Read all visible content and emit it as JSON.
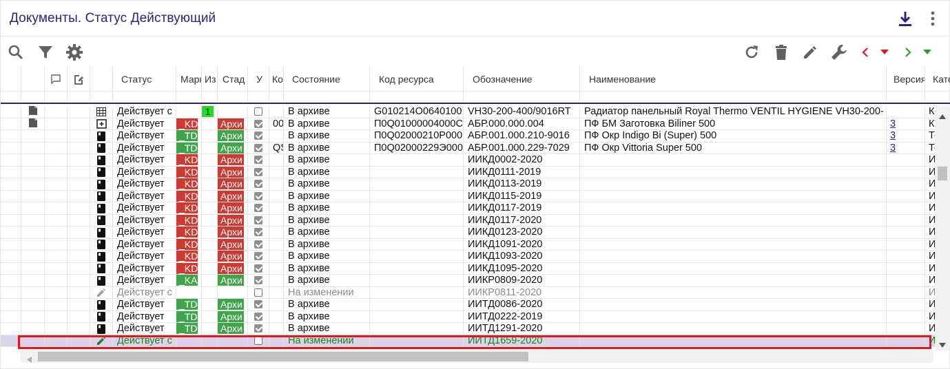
{
  "title": "Документы. Статус Действующий",
  "header_icons": {
    "download": "download-icon",
    "more": "more-vert-icon"
  },
  "toolbar": {
    "left": [
      "search-icon",
      "filter-icon",
      "settings-icon"
    ],
    "right": [
      "refresh-icon",
      "delete-icon",
      "edit-icon",
      "wrench-icon",
      "chevron-left-icon",
      "caret-down-red-icon",
      "chevron-right-icon",
      "caret-down-green-icon"
    ]
  },
  "colors": {
    "title": "#2a2380",
    "selected_row": "#dcd3ea",
    "selection_frame": "#e8141a",
    "tag_red": "#cc3b33",
    "tag_green": "#3fa44a",
    "tag_lime": "#22dd22",
    "back_arrow": "#e8141a",
    "forward_arrow": "#26a326"
  },
  "columns": {
    "status": "Статус",
    "marker": "Марк",
    "iz": "Из",
    "stage": "Стад",
    "u": "У",
    "ko": "Ко",
    "state": "Состояние",
    "code": "Код ресурса",
    "designation": "Обозначение",
    "name": "Наименование",
    "version": "Версия",
    "category": "Кате"
  },
  "rows": [
    {
      "icon": "file-icon",
      "status": "Действует с",
      "marker": "",
      "marker_color": "",
      "iz": "1",
      "stage": "",
      "stage_color": "",
      "checked": false,
      "ko": "",
      "state": "В архиве",
      "code": "G010214О0640100",
      "designation": "VH30-200-400/9016RT",
      "name": "Радиатор панельный Royal Thermo VENTIL HYGIENE VH30-200-",
      "version": "",
      "category": "Ко"
    },
    {
      "icon": "add-box-icon",
      "status": "Действует",
      "marker": "_KD",
      "marker_color": "red",
      "iz": "",
      "stage": "Архи",
      "stage_color": "red",
      "checked": true,
      "ko": "00",
      "state": "В архиве",
      "code": "П0Q01000004000С",
      "designation": "АБР.000.000.004",
      "name": "ПФ БМ Заготовка Biliner 500",
      "version": "3",
      "category": "Ко"
    },
    {
      "icon": "book-icon",
      "status": "Действует",
      "marker": "_TDF",
      "marker_color": "green",
      "iz": "",
      "stage": "Архи",
      "stage_color": "green",
      "checked": true,
      "ko": "",
      "state": "В архиве",
      "code": "П0Q02000210Р000",
      "designation": "АБР.001.000.210-9016",
      "name": "ПФ Окр Indigo Bi (Super) 500",
      "version": "3",
      "category": "Те"
    },
    {
      "icon": "book-icon",
      "status": "Действует",
      "marker": "_TDF",
      "marker_color": "green",
      "iz": "",
      "stage": "Архи",
      "stage_color": "green",
      "checked": true,
      "ko": "QS",
      "state": "В архиве",
      "code": "П0Q02000229Э000",
      "designation": "АБР.001.000.229-7029",
      "name": "ПФ Окр Vittoria Super 500",
      "version": "3",
      "category": "Те"
    },
    {
      "icon": "book-icon",
      "status": "Действует",
      "marker": "_KD",
      "marker_color": "red",
      "iz": "",
      "stage": "Архи",
      "stage_color": "red",
      "checked": true,
      "ko": "",
      "state": "В архиве",
      "code": "",
      "designation": "ИИКД0002-2020",
      "name": "",
      "version": "",
      "category": "И"
    },
    {
      "icon": "book-icon",
      "status": "Действует",
      "marker": "_KD",
      "marker_color": "red",
      "iz": "",
      "stage": "Архи",
      "stage_color": "red",
      "checked": true,
      "ko": "",
      "state": "В архиве",
      "code": "",
      "designation": "ИИКД0111-2019",
      "name": "",
      "version": "",
      "category": "И"
    },
    {
      "icon": "book-icon",
      "status": "Действует",
      "marker": "_KD",
      "marker_color": "red",
      "iz": "",
      "stage": "Архи",
      "stage_color": "red",
      "checked": true,
      "ko": "",
      "state": "В архиве",
      "code": "",
      "designation": "ИИКД0113-2019",
      "name": "",
      "version": "",
      "category": "И"
    },
    {
      "icon": "book-icon",
      "status": "Действует",
      "marker": "_KD",
      "marker_color": "red",
      "iz": "",
      "stage": "Архи",
      "stage_color": "red",
      "checked": true,
      "ko": "",
      "state": "В архиве",
      "code": "",
      "designation": "ИИКД0115-2019",
      "name": "",
      "version": "",
      "category": "И"
    },
    {
      "icon": "book-icon",
      "status": "Действует",
      "marker": "_KD",
      "marker_color": "red",
      "iz": "",
      "stage": "Архи",
      "stage_color": "red",
      "checked": true,
      "ko": "",
      "state": "В архиве",
      "code": "",
      "designation": "ИИКД0117-2019",
      "name": "",
      "version": "",
      "category": "И"
    },
    {
      "icon": "book-icon",
      "status": "Действует",
      "marker": "_KD",
      "marker_color": "red",
      "iz": "",
      "stage": "Архи",
      "stage_color": "red",
      "checked": true,
      "ko": "",
      "state": "В архиве",
      "code": "",
      "designation": "ИИКД0117-2020",
      "name": "",
      "version": "",
      "category": "И"
    },
    {
      "icon": "book-icon",
      "status": "Действует",
      "marker": "_KD",
      "marker_color": "red",
      "iz": "",
      "stage": "Архи",
      "stage_color": "red",
      "checked": true,
      "ko": "",
      "state": "В архиве",
      "code": "",
      "designation": "ИИКД0123-2020",
      "name": "",
      "version": "",
      "category": "И"
    },
    {
      "icon": "book-icon",
      "status": "Действует",
      "marker": "_KD",
      "marker_color": "red",
      "iz": "",
      "stage": "Архи",
      "stage_color": "red",
      "checked": true,
      "ko": "",
      "state": "В архиве",
      "code": "",
      "designation": "ИИКД1091-2020",
      "name": "",
      "version": "",
      "category": "И"
    },
    {
      "icon": "book-icon",
      "status": "Действует",
      "marker": "_KD",
      "marker_color": "red",
      "iz": "",
      "stage": "Архи",
      "stage_color": "red",
      "checked": true,
      "ko": "",
      "state": "В архиве",
      "code": "",
      "designation": "ИИКД1093-2020",
      "name": "",
      "version": "",
      "category": "И"
    },
    {
      "icon": "book-icon",
      "status": "Действует",
      "marker": "_KD",
      "marker_color": "red",
      "iz": "",
      "stage": "Архи",
      "stage_color": "red",
      "checked": true,
      "ko": "",
      "state": "В архиве",
      "code": "",
      "designation": "ИИКД1095-2020",
      "name": "",
      "version": "",
      "category": "И"
    },
    {
      "icon": "book-icon",
      "status": "Действует",
      "marker": "_KAR",
      "marker_color": "green",
      "iz": "",
      "stage": "Архи",
      "stage_color": "green",
      "checked": true,
      "ko": "",
      "state": "В архиве",
      "code": "",
      "designation": "ИИКР0809-2020",
      "name": "",
      "version": "",
      "category": "И"
    },
    {
      "icon": "pencil-icon",
      "status": "Действует с",
      "marker": "",
      "marker_color": "",
      "iz": "",
      "stage": "",
      "stage_color": "",
      "checked": false,
      "ko": "",
      "state": "На изменении",
      "code": "",
      "designation": "ИИКР0811-2020",
      "name": "",
      "version": "",
      "category": "И",
      "muted": true
    },
    {
      "icon": "book-icon",
      "status": "Действует",
      "marker": "_TDF",
      "marker_color": "green",
      "iz": "",
      "stage": "Архи",
      "stage_color": "green",
      "checked": true,
      "ko": "",
      "state": "В архиве",
      "code": "",
      "designation": "ИИТД0086-2020",
      "name": "",
      "version": "",
      "category": "И"
    },
    {
      "icon": "book-icon",
      "status": "Действует",
      "marker": "_TDF",
      "marker_color": "green",
      "iz": "",
      "stage": "Архи",
      "stage_color": "green",
      "checked": true,
      "ko": "",
      "state": "В архиве",
      "code": "",
      "designation": "ИИТД0222-2019",
      "name": "",
      "version": "",
      "category": "И"
    },
    {
      "icon": "book-icon",
      "status": "Действует",
      "marker": "_TDF",
      "marker_color": "green",
      "iz": "",
      "stage": "Архи",
      "stage_color": "green",
      "checked": true,
      "ko": "",
      "state": "В архиве",
      "code": "",
      "designation": "ИИТД1291-2020",
      "name": "",
      "version": "",
      "category": "И"
    },
    {
      "icon": "pencil-icon",
      "status": "Действует с",
      "marker": "",
      "marker_color": "",
      "iz": "",
      "stage": "",
      "stage_color": "",
      "checked": false,
      "ko": "",
      "state": "На изменении",
      "code": "",
      "designation": "ИИТД1659-2020",
      "name": "",
      "version": "",
      "category": "И",
      "selected": true
    }
  ]
}
